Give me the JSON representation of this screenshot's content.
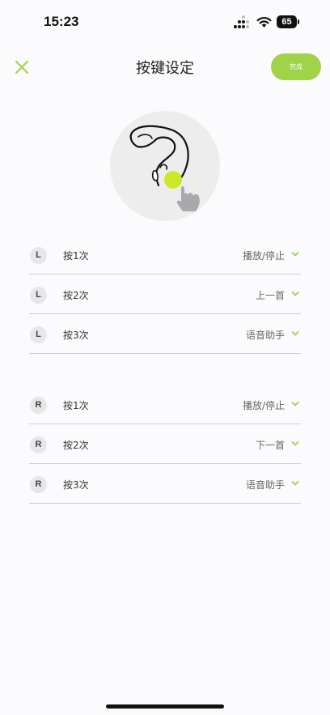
{
  "status_bar": {
    "time": "15:23",
    "battery": "65"
  },
  "header": {
    "title": "按键设定",
    "done_label": "完成",
    "close_icon": "close-icon"
  },
  "colors": {
    "accent": "#9ed34a",
    "background": "#fbfafc"
  },
  "left_rows": [
    {
      "side": "L",
      "press": "按1次",
      "action": "播放/停止"
    },
    {
      "side": "L",
      "press": "按2次",
      "action": "上一首"
    },
    {
      "side": "L",
      "press": "按3次",
      "action": "语音助手"
    }
  ],
  "right_rows": [
    {
      "side": "R",
      "press": "按1次",
      "action": "播放/停止"
    },
    {
      "side": "R",
      "press": "按2次",
      "action": "下一首"
    },
    {
      "side": "R",
      "press": "按3次",
      "action": "语音助手"
    }
  ]
}
